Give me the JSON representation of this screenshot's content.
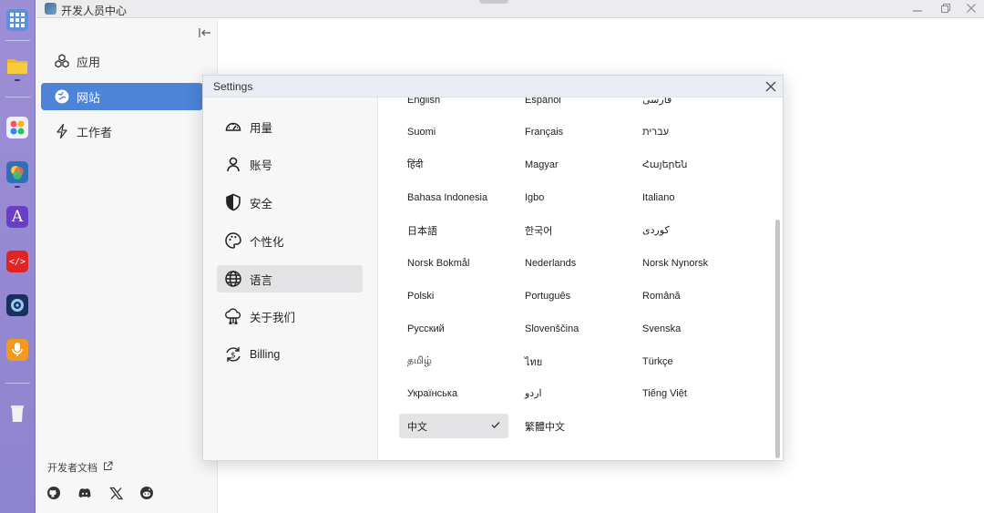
{
  "titlebar": {
    "title": "开发人员中心"
  },
  "dock": {
    "icons": [
      "apps-grid-icon",
      "files-icon",
      "app-store-icon",
      "photos-icon",
      "dictionary-icon",
      "code-editor-icon",
      "camera-icon",
      "voice-recorder-icon",
      "trash-icon"
    ]
  },
  "sidebar": {
    "items": [
      {
        "label": "应用",
        "icon": "cubes-icon"
      },
      {
        "label": "网站",
        "icon": "globe-icon",
        "active": true
      },
      {
        "label": "工作者",
        "icon": "bolt-icon"
      }
    ],
    "dev_docs_label": "开发者文档",
    "social": [
      "github-icon",
      "discord-icon",
      "x-icon",
      "reddit-icon"
    ]
  },
  "dialog": {
    "title": "Settings",
    "nav": [
      {
        "label": "用量",
        "icon": "gauge-icon"
      },
      {
        "label": "账号",
        "icon": "user-icon"
      },
      {
        "label": "安全",
        "icon": "shield-icon"
      },
      {
        "label": "个性化",
        "icon": "palette-icon"
      },
      {
        "label": "语言",
        "icon": "globe-icon",
        "active": true
      },
      {
        "label": "关于我们",
        "icon": "about-icon"
      },
      {
        "label": "Billing",
        "icon": "billing-icon"
      }
    ],
    "languages": [
      [
        "English",
        "Español",
        "فارسی"
      ],
      [
        "Suomi",
        "Français",
        "עברית"
      ],
      [
        "हिंदी",
        "Magyar",
        "Հայերեն"
      ],
      [
        "Bahasa Indonesia",
        "Igbo",
        "Italiano"
      ],
      [
        "日本語",
        "한국어",
        "کوردی"
      ],
      [
        "Norsk Bokmål",
        "Nederlands",
        "Norsk Nynorsk"
      ],
      [
        "Polski",
        "Português",
        "Română"
      ],
      [
        "Русский",
        "Slovenščina",
        "Svenska"
      ],
      [
        "தமிழ்",
        "ไทย",
        "Türkçe"
      ],
      [
        "Українська",
        "اردو",
        "Tiếng Việt"
      ],
      [
        "中文",
        "繁體中文"
      ]
    ],
    "selected_language": "中文",
    "colors": {
      "accent": "#4d84d8",
      "selected_bg": "#e3e3e5",
      "header_bg": "#e9eef5"
    }
  }
}
